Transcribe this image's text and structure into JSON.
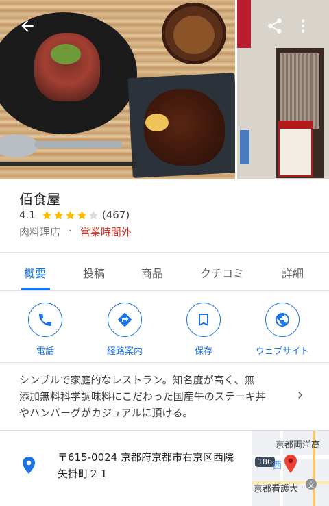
{
  "place": {
    "name": "佰食屋",
    "rating": "4.1",
    "stars_filled": 4,
    "stars_total": 5,
    "review_count": "(467)",
    "category": "肉料理店",
    "separator": "·",
    "status": "営業時間外"
  },
  "header_icons": {
    "back": "arrow-back-icon",
    "share": "share-icon",
    "more": "more-vert-icon"
  },
  "tabs": [
    {
      "label": "概要",
      "active": true
    },
    {
      "label": "投稿",
      "active": false
    },
    {
      "label": "商品",
      "active": false
    },
    {
      "label": "クチコミ",
      "active": false
    },
    {
      "label": "詳細",
      "active": false
    }
  ],
  "actions": [
    {
      "label": "電話",
      "icon": "phone-icon"
    },
    {
      "label": "経路案内",
      "icon": "directions-icon"
    },
    {
      "label": "保存",
      "icon": "bookmark-icon"
    },
    {
      "label": "ウェブサイト",
      "icon": "globe-icon"
    }
  ],
  "description": {
    "line1": "シンプルで家庭的なレストラン。知名度が高く、無",
    "line2": "添加無料科学調味料にこだわった国産牛のステーキ丼",
    "line3": "やハンバーグがカジュアルに頂ける。"
  },
  "address": {
    "line1": "〒615-0024 京都府京都市右京区西院",
    "line2": "矢掛町２１"
  },
  "map": {
    "label_top": "京都両洋高",
    "label_route": "186",
    "label_mid": "西",
    "label_bottom": "京都看護大"
  },
  "colors": {
    "accent": "#1a73e8",
    "closed": "#d93025",
    "star": "#fbbc04",
    "pin": "#1a73e8",
    "map_pin": "#ea4335"
  }
}
